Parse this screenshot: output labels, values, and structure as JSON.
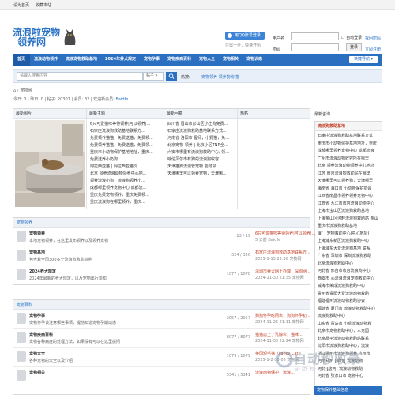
{
  "topbar": {
    "home": "设为首页",
    "fav": "收藏本站"
  },
  "header": {
    "logo_line1": "流浪啦宠物",
    "logo_line2": "领养网",
    "qq_login": "用QQ账号登录",
    "qq_sub": "只需一步，快速开始",
    "username_label": "用户名",
    "password_label": "密码",
    "auto_login": "自动登录",
    "forgot": "找回密码",
    "register": "立即注册",
    "login_button": "登录"
  },
  "nav": {
    "items": [
      "首页",
      "流浪动物领养",
      "流浪宠物救助基地",
      "2024年养犬规定",
      "宠物孕事",
      "宠物疾病百科",
      "宠物大全",
      "宠物相关",
      "宠物训练"
    ],
    "quick": "快捷导航 ▾"
  },
  "search": {
    "placeholder": "请输入搜索内容",
    "type": "帖子",
    "hot_label": "热搜:",
    "hot_links": "宠物领养  领养狗狗  猫"
  },
  "breadcrumb": "⌂ › 宠物网",
  "forum_stats": {
    "text": "今日: 0 | 昨日: 0 | 帖子: 20307 | 会员: 32 | 欢迎新会员: ",
    "new_member": "Baidfe"
  },
  "panel": {
    "col1": "最新图片",
    "col2": "最新主题",
    "col3": "最新回复",
    "col4": "热帖",
    "new_topics": [
      "6只可爱猫咪等待领养|可以领养|...",
      "石家庄流浪狗救助基地联系方...",
      "免费领养猫猫，免费送猫，免费领...",
      "免费领养猫猫，免费送猫，免费领...",
      "重庆市小动物保护基地地址，重庆...",
      "免费送养小奶狗",
      "阿拉西亚猫 | 网拉西亚猫价...",
      "北京 领养流浪动物领养中心地...",
      "领养流浪小狗，流浪狗领养小...",
      "成都哪里领养宠物中心 成都流...",
      "重庆免费宠物领养，重庆免费领...",
      "重庆流浪狗在哪里领养，重庆..."
    ],
    "new_replies": [
      "四川省 眉山市彭山区小土狗免费...",
      "石家庄流浪狗救助基地联系方式...",
      "河南省 洛阳市 偃师，小野猫，免...",
      "北京宠物-领养 | 北京小区TNR全...",
      "六安市哪里有流浪狗救助中心, 领...",
      "呼伦贝尔市有狗的流浪狗收容...",
      "天津猫狗流浪管宠物 能可领...",
      "天津哪里可以领养宠物，天津哪..."
    ]
  },
  "sidebar": {
    "title": "最新咨询",
    "box_title": "流浪狗救助基地",
    "items": [
      "石家庄流浪狗救助基地联系方式",
      "重庆市小动物保护基地地址，重庆",
      "成都哪里领养宠物中心 成都流浪",
      "广州市流浪动物收容所在哪里",
      "北京 领养流浪动物领养中心地址",
      "江苏 南京流浪狗救助站在哪里",
      "天津哪里可以领养狗，天津哪里",
      "海南省 海口市 小动物保护协会",
      "江西省南昌市领养领养宠物中心",
      "江西省 九江市收容流浪动物中心",
      "上海市宝山区流浪狗救助基地",
      "上海金山区河畔流浪狗救助站 金山",
      "重庆市流浪狗救助基地",
      "厦门 宠物救助中心(中心地址)",
      "上海浦东新区流浪狗救助中心",
      "上海浦东大爱流浪狗基地 联系",
      "广东省 深圳市 深圳流浪狗救助",
      "北京流浪狗救助中心",
      "河北省 邢台市收容流浪狗中心",
      "西安市 心流浪流浪宠物救助中心",
      "威海市荣成流浪狗救助中心",
      "贵州省贵阳大爱流浪动物救助",
      "福建福州流浪动物救助协会",
      "福建省 厦门市 流浪动物救助中心",
      "流浪狗救助中心",
      "山东省 青岛市 小乖流浪动物救",
      "北京市宠物救助中心，人宠园",
      "北京昌平流浪动物救助站联系",
      "沈阳市流浪狗救助中心，流浪",
      "浙江温州市流浪狗领养 杭州市",
      "河南郑州 [郑州] 流浪动物",
      "河北 [唐河] 流浪动物救助",
      "河北省 张家口市 宠物中心"
    ],
    "footer": "宠物保养基础信息"
  },
  "boards": [
    {
      "title": "宠物领养",
      "rows": [
        {
          "name": "宠物领养",
          "desc": "本地宠物领养，在这里发布领养以及领养宠物",
          "count": "13 / 19",
          "last": "6只可爱猫咪等待领养|可以领养|...",
          "meta": "5 天前 Baidfe"
        },
        {
          "name": "宠物基地",
          "desc": "包含着全国300多个流浪狗救助基地",
          "count": "324 / 326",
          "last": "石家庄流浪狗救助基地联系方...",
          "meta": "2025-1-15 22:36 宠物网"
        },
        {
          "name": "2024养犬规定",
          "desc": "2024年最新的养犬规定，以及宠物出行须知",
          "count": "1077 / 1078",
          "last": "深圳市养犬网上办理，深圳网...",
          "meta": "2024-11-30 21:35 宠物网"
        }
      ]
    },
    {
      "title": "宠物百科",
      "rows": [
        {
          "name": "宠物孕事",
          "desc": "宠物怀孕该注意哪些事项，提前知道宠物孕期动态",
          "count": "2057 / 2057",
          "last": "狗狗怀孕时间表，狗狗怀孕初...",
          "meta": "2024-11-26 21:11 宠物网"
        },
        {
          "name": "宠物疾病百科",
          "desc": "宠物各种病症的处理方法，如果没有可以在这里提问",
          "count": "8077 / 8077",
          "last": "猫猫患上了乳腺炎，猫咪...",
          "meta": "2024-11-30 22:24 宠物网"
        },
        {
          "name": "宠物大全",
          "desc": "各种宠物的大全以及介绍",
          "count": "1079 / 1079",
          "last": "英国短毛猫（Fancy Cat）",
          "meta": "2025-1-2 00:06 宠物网"
        },
        {
          "name": "宠物相关",
          "desc": "",
          "count": "5341 / 5341",
          "last": "流浪动物保护，流浪...",
          "meta": ""
        }
      ]
    }
  ],
  "watermark": {
    "text": "自动秒收录",
    "sub": "自·动·秒·收·录"
  },
  "colors": {
    "nav": "#2b6fc1",
    "accent": "#c23b22",
    "link": "#2a73c4"
  }
}
